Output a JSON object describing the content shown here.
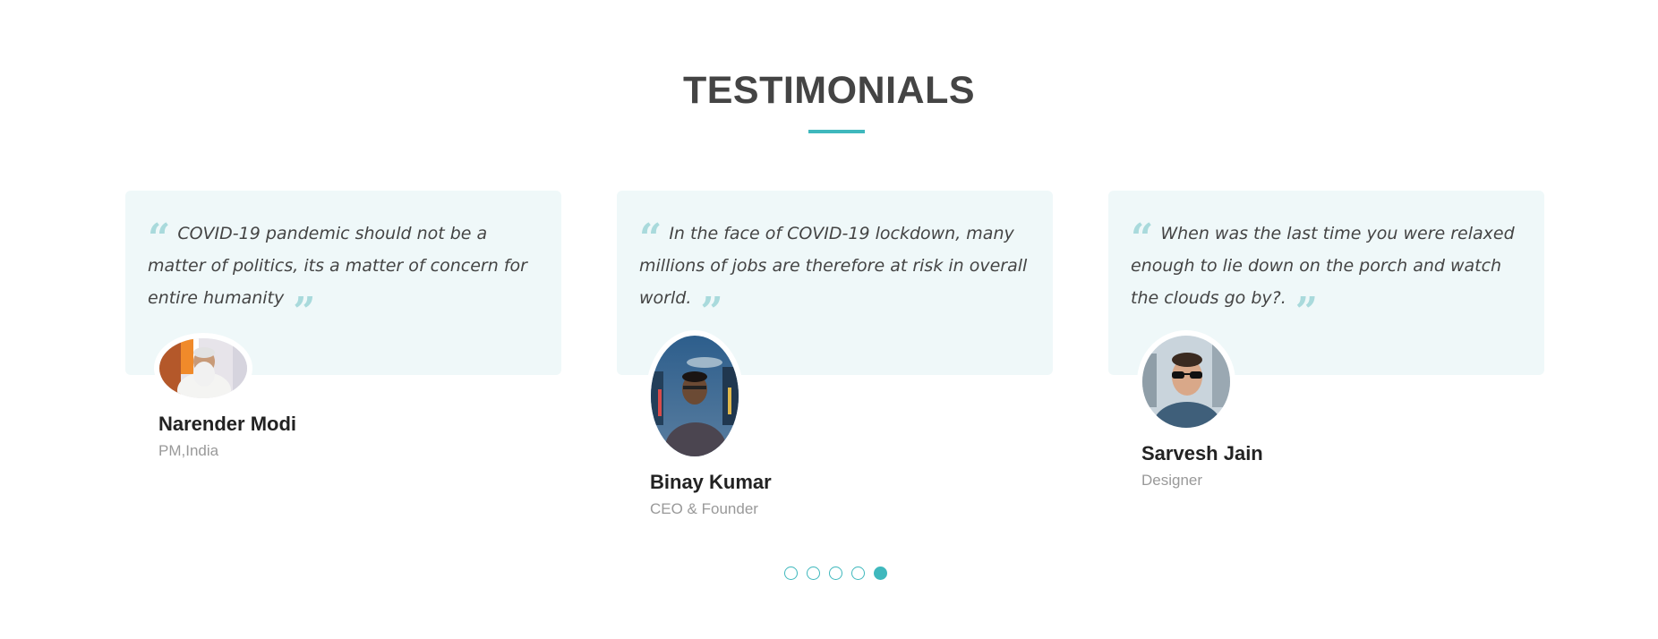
{
  "section": {
    "title": "TESTIMONIALS",
    "accent_color": "#3fb8bd",
    "card_background": "#eff8f9"
  },
  "testimonials": [
    {
      "quote": "COVID-19 pandemic should not be a matter of politics, its a matter of concern for entire humanity",
      "name": "Narender Modi",
      "role": "PM,India",
      "avatar": "photo-man-white-beard-icon"
    },
    {
      "quote": "In the face of COVID-19 lockdown, many millions of jobs are therefore at risk in overall world.",
      "name": "Binay Kumar",
      "role": "CEO & Founder",
      "avatar": "photo-man-city-night-icon"
    },
    {
      "quote": "When was the last time you were relaxed enough to lie down on the porch and watch the clouds go by?.",
      "name": "Sarvesh Jain",
      "role": "Designer",
      "avatar": "photo-man-sunglasses-icon"
    }
  ],
  "quote_marks": {
    "open": "“",
    "close": "”"
  },
  "pagination": {
    "total": 5,
    "active": 5
  }
}
